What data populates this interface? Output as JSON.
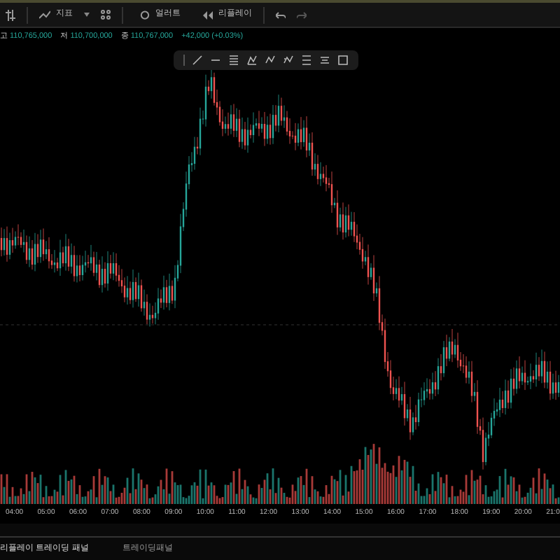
{
  "toolbar": {
    "indicators": "지표",
    "alerts": "얼러트",
    "replay": "리플레이"
  },
  "ohlc": [
    {
      "label": "고",
      "value": "110,765,000"
    },
    {
      "label": "저",
      "value": "110,700,000"
    },
    {
      "label": "종",
      "value": "110,767,000"
    }
  ],
  "change": "+42,000 (+0.03%)",
  "time_axis": [
    "04:00",
    "05:00",
    "06:00",
    "07:00",
    "08:00",
    "09:00",
    "10:00",
    "11:00",
    "12:00",
    "13:00",
    "14:00",
    "15:00",
    "16:00",
    "17:00",
    "18:00",
    "19:00",
    "20:00",
    "21:0"
  ],
  "bottom_tabs": [
    {
      "label": "리플레이 트레이딩 패널",
      "selected": true
    },
    {
      "label": "트레이딩패널",
      "selected": false
    }
  ]
}
